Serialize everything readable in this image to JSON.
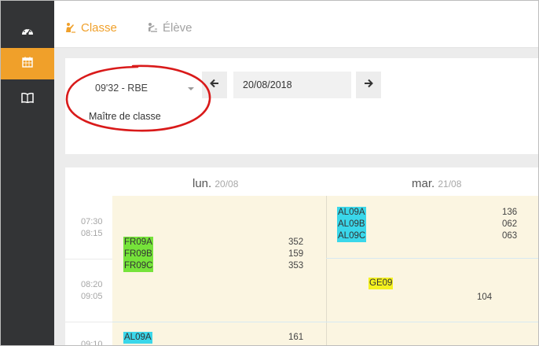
{
  "colors": {
    "accent": "#f0a02a",
    "sidebar": "#333436",
    "green_tag": "#76e33a",
    "cyan_tag": "#3ad7ea",
    "yellow_tag": "#f4f11f",
    "annotation": "#d91a1a"
  },
  "sidebar": {
    "items": [
      {
        "icon": "dashboard-icon",
        "active": false
      },
      {
        "icon": "calendar-icon",
        "active": true
      },
      {
        "icon": "book-icon",
        "active": false
      }
    ]
  },
  "tabs": [
    {
      "label": "Classe",
      "icon": "teacher-icon",
      "active": true
    },
    {
      "label": "Élève",
      "icon": "student-icon",
      "active": false
    }
  ],
  "toolbar": {
    "class_select": {
      "value": "09'32 - RBE",
      "sub_label": "Maître de classe"
    },
    "date": "20/08/2018",
    "prev_icon": "arrow-left-icon",
    "next_icon": "arrow-right-icon"
  },
  "timetable": {
    "days": [
      {
        "name": "lun.",
        "date": "20/08"
      },
      {
        "name": "mar.",
        "date": "21/08"
      }
    ],
    "slots": [
      {
        "start": "07:30",
        "end": "08:15"
      },
      {
        "start": "08:20",
        "end": "09:05"
      },
      {
        "start": "09:10",
        "end": ""
      }
    ],
    "lessons": {
      "lun_a": {
        "groups": [
          "FR09A",
          "FR09B",
          "FR09C"
        ],
        "rooms": [
          "352",
          "159",
          "353"
        ]
      },
      "lun_b": {
        "groups": [
          "AL09A"
        ],
        "rooms": [
          "161"
        ]
      },
      "mar_a": {
        "groups": [
          "AL09A",
          "AL09B",
          "AL09C"
        ],
        "rooms": [
          "136",
          "062",
          "063"
        ]
      },
      "mar_b": {
        "groups": [
          "GE09"
        ],
        "rooms": [
          "104"
        ]
      }
    }
  }
}
